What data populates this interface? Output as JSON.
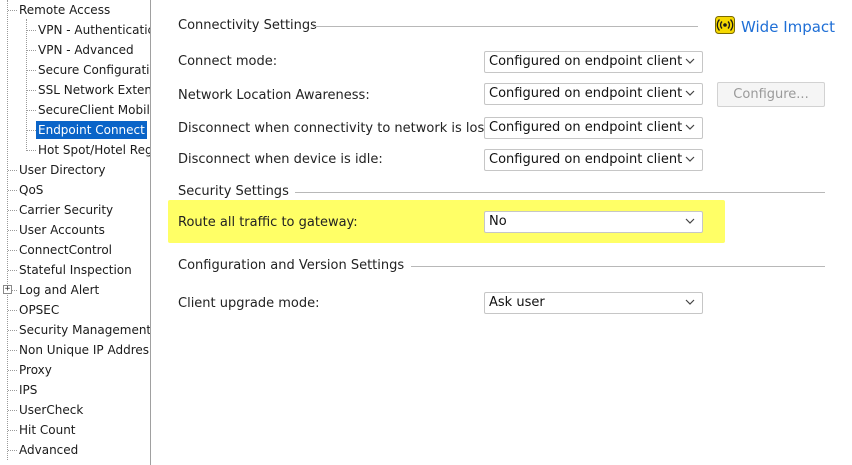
{
  "tree": {
    "items": [
      {
        "label": "Remote Access"
      },
      {
        "label": "VPN - Authenticatic"
      },
      {
        "label": "VPN - Advanced"
      },
      {
        "label": "Secure Configuratic"
      },
      {
        "label": "SSL Network Extenc"
      },
      {
        "label": "SecureClient Mobile"
      },
      {
        "label": "Endpoint Connect"
      },
      {
        "label": "Hot Spot/Hotel Reg"
      },
      {
        "label": "User Directory"
      },
      {
        "label": "QoS"
      },
      {
        "label": "Carrier Security"
      },
      {
        "label": "User Accounts"
      },
      {
        "label": "ConnectControl"
      },
      {
        "label": "Stateful Inspection"
      },
      {
        "label": "Log and Alert"
      },
      {
        "label": "OPSEC"
      },
      {
        "label": "Security Management"
      },
      {
        "label": "Non Unique IP Addres"
      },
      {
        "label": "Proxy"
      },
      {
        "label": "IPS"
      },
      {
        "label": "UserCheck"
      },
      {
        "label": "Hit Count"
      },
      {
        "label": "Advanced"
      }
    ],
    "selected_index": 6
  },
  "wide_impact": {
    "label": "Wide Impact",
    "icon": "broadcast-icon",
    "color": "#1f6fd6"
  },
  "connectivity": {
    "title": "Connectivity Settings",
    "connect_mode": {
      "label": "Connect mode:",
      "value": "Configured on endpoint client"
    },
    "nla": {
      "label": "Network Location Awareness:",
      "value": "Configured on endpoint client",
      "button": "Configure..."
    },
    "disconnect_lost": {
      "label": "Disconnect when connectivity to network is lost:",
      "value": "Configured on endpoint client"
    },
    "disconnect_idle": {
      "label": "Disconnect when device is idle:",
      "value": "Configured on endpoint client"
    }
  },
  "security": {
    "title": "Security Settings",
    "route_all": {
      "label": "Route all traffic to gateway:",
      "value": "No"
    },
    "highlight_color": "#ffff66"
  },
  "config_version": {
    "title": "Configuration and Version Settings",
    "upgrade_mode": {
      "label": "Client upgrade mode:",
      "value": "Ask user"
    }
  },
  "colors": {
    "selection": "#0a64c8",
    "link": "#1f6fd6"
  }
}
